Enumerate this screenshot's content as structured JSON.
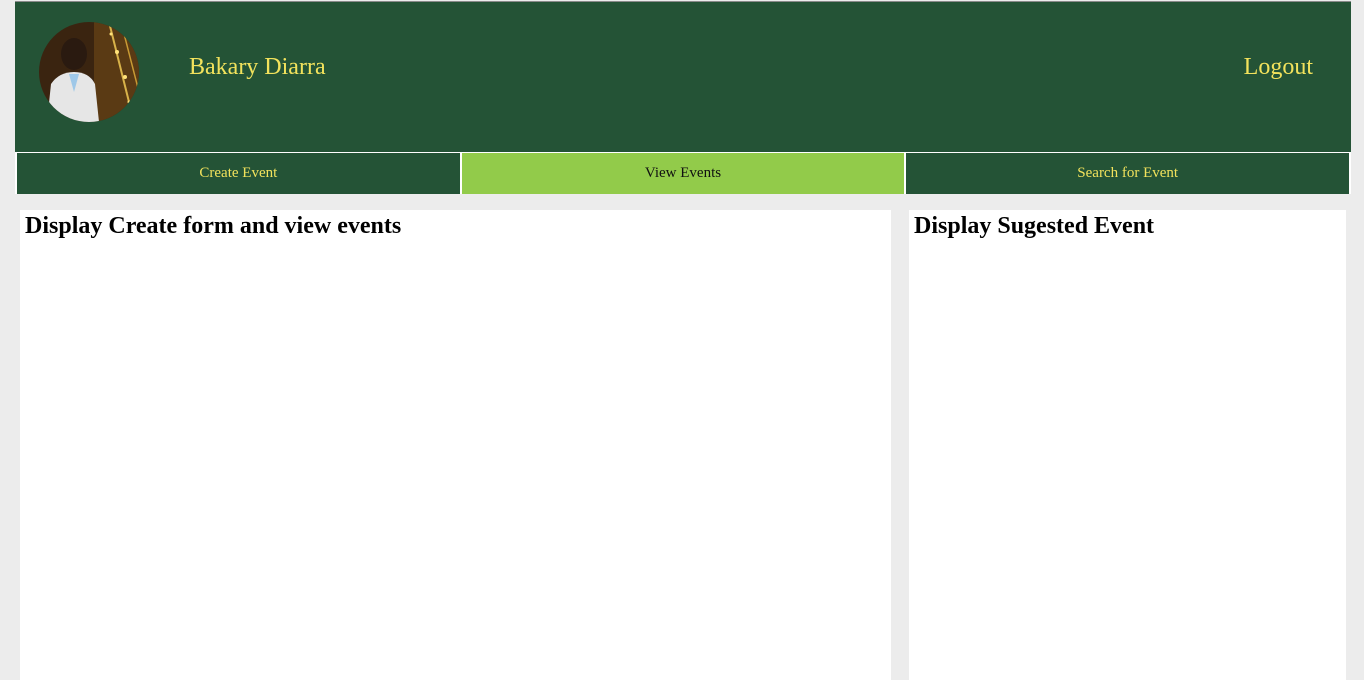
{
  "header": {
    "user_name": "Bakary Diarra",
    "logout_label": "Logout"
  },
  "nav": {
    "tabs": [
      {
        "label": "Create Event",
        "active": false
      },
      {
        "label": "View Events",
        "active": true
      },
      {
        "label": "Search for Event",
        "active": false
      }
    ]
  },
  "main": {
    "title": "Display Create form and view events"
  },
  "sidebar": {
    "title": "Display Sugested Event"
  },
  "colors": {
    "header_bg": "#245336",
    "accent_text": "#f2e25c",
    "active_tab": "#92cb4a",
    "page_bg": "#ececec"
  }
}
